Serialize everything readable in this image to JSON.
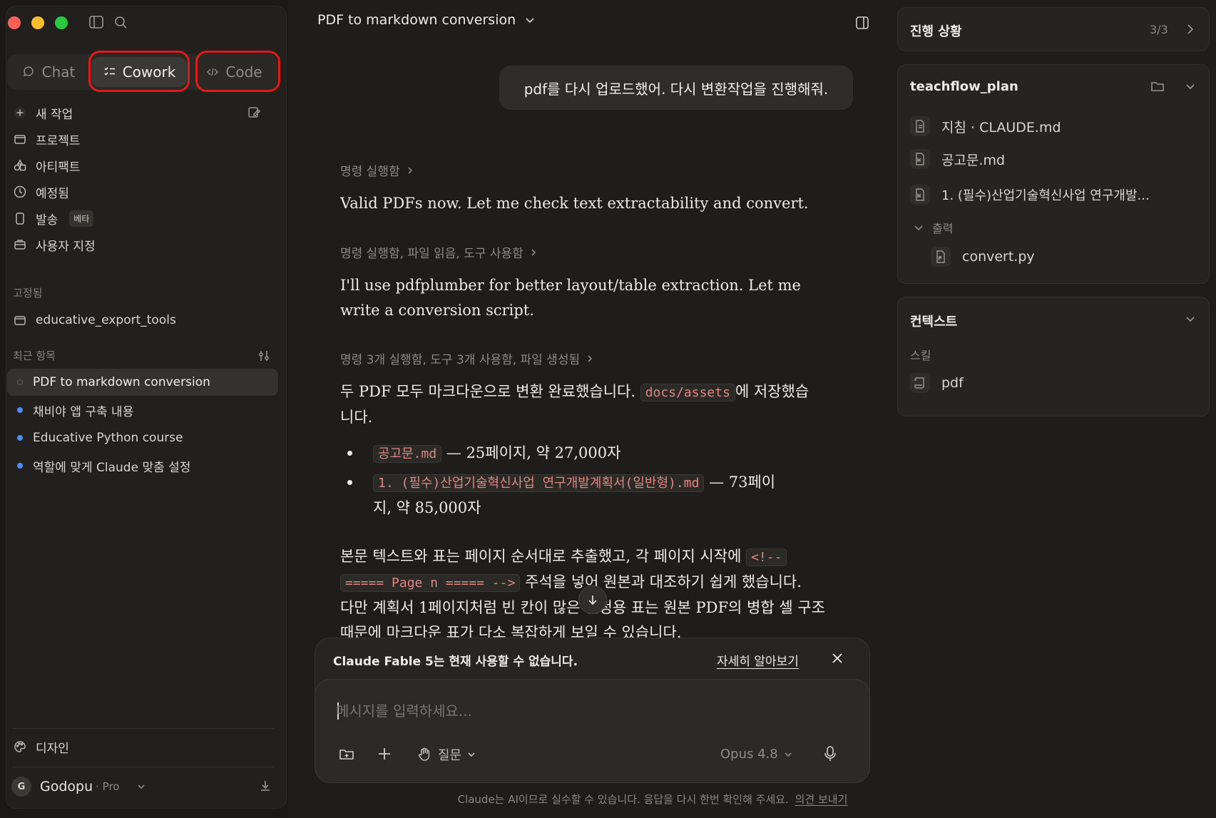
{
  "sidebar": {
    "modes": [
      {
        "label": "Chat"
      },
      {
        "label": "Cowork"
      },
      {
        "label": "Code"
      }
    ],
    "nav": [
      {
        "label": "새 작업"
      },
      {
        "label": "프로젝트"
      },
      {
        "label": "아티팩트"
      },
      {
        "label": "예정됨"
      },
      {
        "label": "발송",
        "badge": "베타"
      },
      {
        "label": "사용자 지정"
      }
    ],
    "pinned_label": "고정됨",
    "pinned": [
      {
        "label": "educative_export_tools"
      }
    ],
    "recent_label": "최근 항목",
    "recent": [
      {
        "label": "PDF to markdown conversion"
      },
      {
        "label": "채비야 앱 구축 내용"
      },
      {
        "label": "Educative Python course"
      },
      {
        "label": "역할에 맞게 Claude 맞춤 설정"
      }
    ],
    "design_label": "디자인",
    "user": {
      "initial": "G",
      "name": "Godopu",
      "plan": "· Pro"
    }
  },
  "header": {
    "title": "PDF to markdown conversion"
  },
  "conversation": {
    "user_message": "pdf를 다시 업로드했어. 다시 변환작업을 진행해줘.",
    "steps": [
      "명령 실행함",
      "명령 실행함, 파일 읽음, 도구 사용함",
      "명령 3개 실행함, 도구 3개 사용함, 파일 생성됨"
    ],
    "p1": "Valid PDFs now. Let me check text extractability and convert.",
    "p2_line1": "I'll use pdfplumber for better layout/table extraction. Let me",
    "p2_line2": "write a conversion script.",
    "p3_pre": "두 PDF 모두 마크다운으로 변환 완료했습니다.",
    "p3_code": "docs/assets",
    "p3_post1": "에 저장했습",
    "p3_post2": "니다.",
    "bullets": [
      {
        "code": "공고문.md",
        "text1": "— 25페이지, 약 27,000자",
        "text2": ""
      },
      {
        "code": "1. (필수)산업기술혁신사업 연구개발계획서(일반형).md",
        "text1": "— 73페이",
        "text2": "지, 약 85,000자"
      }
    ],
    "p4_l1_pre": "본문 텍스트와 표는 페이지 순서대로 추출했고, 각 페이지 시작에",
    "p4_code1": "<!--",
    "p4_code2": "===== Page n ===== -->",
    "p4_l2_post": "주석을 넣어 원본과 대조하기 쉽게 했습니다.",
    "p4_l3": "다만 계획서 1페이지처럼 빈 칸이 많은 신청용 표는 원본 PDF의 병합 셀 구조",
    "p4_l4": "때문에 마크다운 표가 다소 복잡하게 보일 수 있습니다."
  },
  "notice": {
    "text": "Claude Fable 5는 현재 사용할 수 없습니다.",
    "link": "자세히 알아보기"
  },
  "composer": {
    "placeholder": "메시지를 입력하세요...",
    "mode": "질문",
    "model": "Opus 4.8"
  },
  "footer": {
    "text": "Claude는 AI이므로 실수할 수 있습니다. 응답을 다시 한번 확인해 주세요.",
    "link": "의견 보내기"
  },
  "right": {
    "progress": {
      "title": "진행 상황",
      "count": "3/3"
    },
    "plan": {
      "title": "teachflow_plan",
      "files": [
        {
          "label": "지침 · CLAUDE.md"
        },
        {
          "label": "공고문.md"
        },
        {
          "label": "1. (필수)산업기술혁신사업 연구개발..."
        }
      ],
      "output_label": "출력",
      "output_files": [
        {
          "label": "convert.py"
        }
      ]
    },
    "context": {
      "title": "컨텍스트",
      "skills_label": "스킬",
      "skills": [
        {
          "label": "pdf"
        }
      ]
    }
  },
  "colors": {
    "accent_blue": "#4a8ef0",
    "code_red": "#e2867f",
    "highlight_red": "#e11919"
  }
}
